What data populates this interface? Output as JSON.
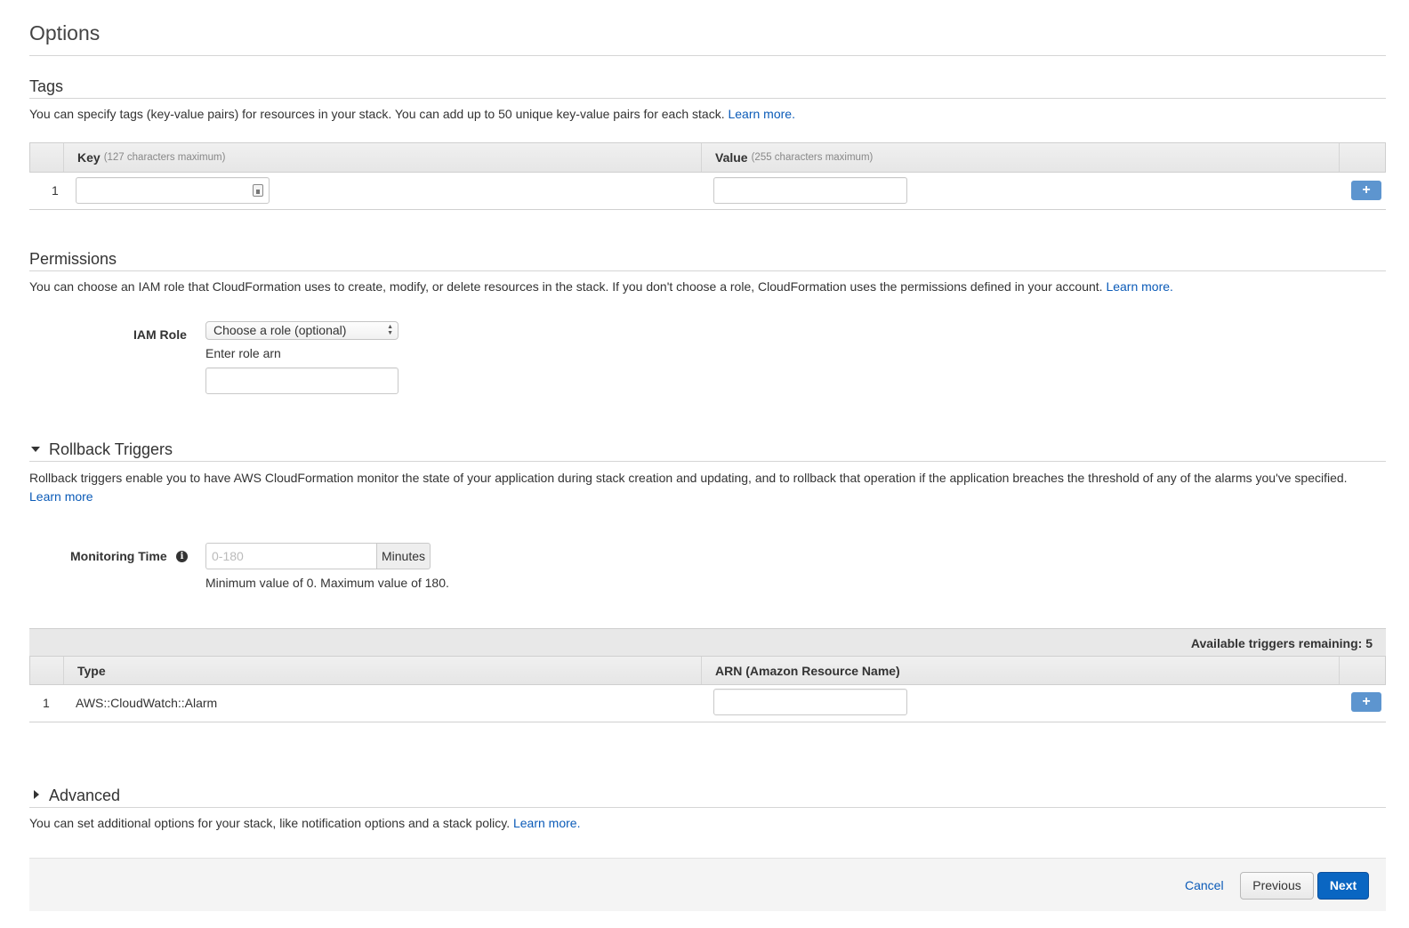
{
  "page_title": "Options",
  "tags": {
    "title": "Tags",
    "description": "You can specify tags (key-value pairs) for resources in your stack. You can add up to 50 unique key-value pairs for each stack.",
    "learn_more": "Learn more.",
    "columns": {
      "key_label": "Key",
      "key_hint": "(127 characters maximum)",
      "value_label": "Value",
      "value_hint": "(255 characters maximum)"
    },
    "rows": [
      {
        "index": "1",
        "key": "",
        "value": ""
      }
    ],
    "add_label": "+"
  },
  "permissions": {
    "title": "Permissions",
    "description": "You can choose an IAM role that CloudFormation uses to create, modify, or delete resources in the stack. If you don't choose a role, CloudFormation uses the permissions defined in your account.",
    "learn_more": "Learn more.",
    "iam_role_label": "IAM Role",
    "role_select_value": "Choose a role (optional)",
    "enter_role_arn_label": "Enter role arn",
    "role_arn_value": ""
  },
  "rollback": {
    "title": "Rollback Triggers",
    "expanded": true,
    "description": "Rollback triggers enable you to have AWS CloudFormation monitor the state of your application during stack creation and updating, and to rollback that operation if the application breaches the threshold of any of the alarms you've specified.",
    "learn_more": "Learn more",
    "monitoring_time_label": "Monitoring Time",
    "monitoring_time_placeholder": "0-180",
    "monitoring_time_unit": "Minutes",
    "monitoring_time_help": "Minimum value of 0. Maximum value of 180.",
    "triggers_remaining": "Available triggers remaining: 5",
    "columns": {
      "type": "Type",
      "arn": "ARN (Amazon Resource Name)"
    },
    "rows": [
      {
        "index": "1",
        "type": "AWS::CloudWatch::Alarm",
        "arn": ""
      }
    ],
    "add_label": "+"
  },
  "advanced": {
    "title": "Advanced",
    "expanded": false,
    "description": "You can set additional options for your stack, like notification options and a stack policy.",
    "learn_more": "Learn more."
  },
  "footer": {
    "cancel": "Cancel",
    "previous": "Previous",
    "next": "Next"
  },
  "colors": {
    "link": "#0b5bb8",
    "primary_button": "#0a66c2",
    "add_button": "#5d95cf"
  }
}
